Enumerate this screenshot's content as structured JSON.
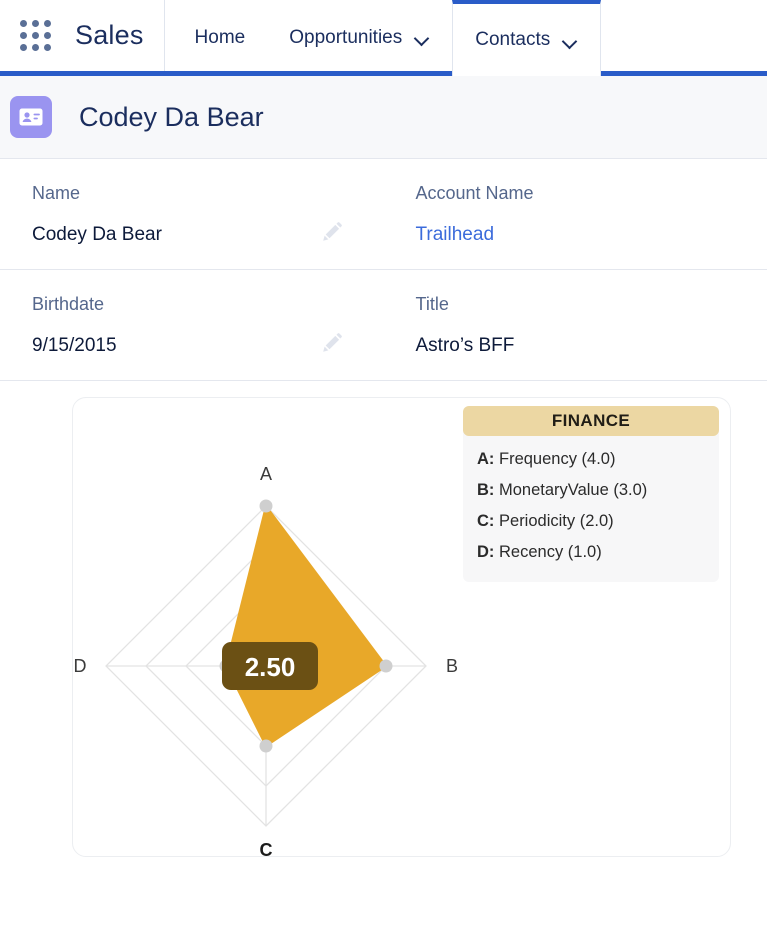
{
  "global_nav": {
    "app_launcher_icon": "app-launcher-grid-icon",
    "app_name": "Sales",
    "tabs": [
      {
        "label": "Home",
        "has_menu": false,
        "active": false
      },
      {
        "label": "Opportunities",
        "has_menu": true,
        "active": false
      },
      {
        "label": "Contacts",
        "has_menu": true,
        "active": true
      }
    ]
  },
  "record": {
    "icon": "contact-card-icon",
    "title": "Codey Da Bear",
    "fields": [
      {
        "label": "Name",
        "value": "Codey Da Bear",
        "is_link": false,
        "edit_icon": "pencil-icon"
      },
      {
        "label": "Account Name",
        "value": "Trailhead",
        "is_link": true,
        "edit_icon": null
      },
      {
        "label": "Birthdate",
        "value": "9/15/2015",
        "is_link": false,
        "edit_icon": "pencil-icon"
      },
      {
        "label": "Title",
        "value": "Astro’s BFF",
        "is_link": false,
        "edit_icon": null
      }
    ]
  },
  "legend": {
    "header": "FINANCE",
    "items": [
      {
        "key": "A:",
        "text": " Frequency (4.0)"
      },
      {
        "key": "B:",
        "text": " MonetaryValue (3.0)"
      },
      {
        "key": "C:",
        "text": " Periodicity (2.0)"
      },
      {
        "key": "D:",
        "text": " Recency (1.0)"
      }
    ]
  },
  "chart_data": {
    "type": "radar",
    "title": "FINANCE",
    "categories": [
      "A",
      "B",
      "C",
      "D"
    ],
    "category_names": [
      "Frequency",
      "MonetaryValue",
      "Periodicity",
      "Recency"
    ],
    "values": [
      4.0,
      3.0,
      2.0,
      1.0
    ],
    "rmin": 0,
    "rmax": 4.0,
    "rings": 4,
    "grid": true,
    "legend_position": "top-right",
    "angles_deg": [
      90,
      0,
      270,
      180
    ],
    "fill_color": "#E8A829",
    "grid_color": "#e3e3e3",
    "point_color": "#cfcfcf",
    "tooltip": {
      "value": "2.50",
      "at_category": "D",
      "bg_color": "#6b5014",
      "text_color": "#ffffff"
    },
    "hovered_category": "C"
  },
  "colors": {
    "nav_accent": "#2a5cc8",
    "brand_text": "#1b2e5e",
    "link": "#3b6bdb",
    "avatar_bg": "#9a94f0",
    "legend_header_bg": "#ecd7a3",
    "chart_gold": "#E8A829"
  }
}
